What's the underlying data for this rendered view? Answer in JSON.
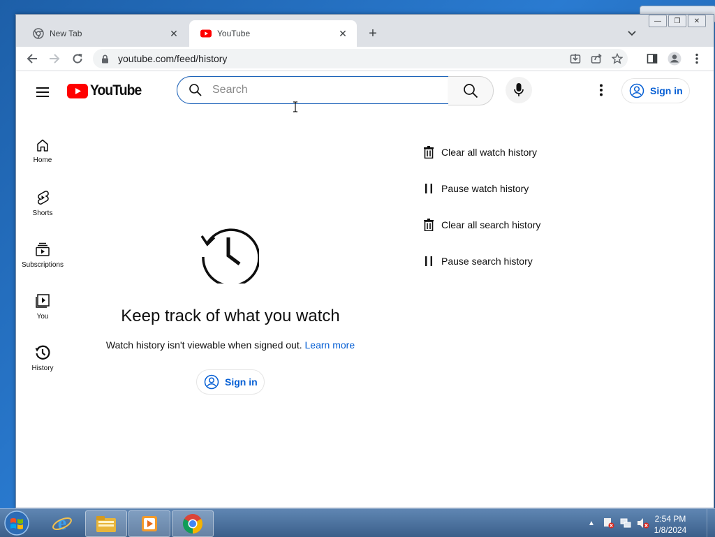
{
  "browser": {
    "tabs": [
      {
        "title": "New Tab",
        "active": false
      },
      {
        "title": "YouTube",
        "active": true
      }
    ],
    "url": "youtube.com/feed/history"
  },
  "youtube": {
    "logo_text": "YouTube",
    "search_placeholder": "Search",
    "signin_label": "Sign in",
    "nav": [
      {
        "label": "Home",
        "icon": "home-icon"
      },
      {
        "label": "Shorts",
        "icon": "shorts-icon"
      },
      {
        "label": "Subscriptions",
        "icon": "subscriptions-icon"
      },
      {
        "label": "You",
        "icon": "you-icon"
      },
      {
        "label": "History",
        "icon": "history-icon"
      }
    ],
    "empty_state": {
      "headline": "Keep track of what you watch",
      "message": "Watch history isn't viewable when signed out.",
      "link": "Learn more",
      "signin_label": "Sign in"
    },
    "actions": [
      {
        "label": "Clear all watch history",
        "icon": "trash-icon"
      },
      {
        "label": "Pause watch history",
        "icon": "pause-icon"
      },
      {
        "label": "Clear all search history",
        "icon": "trash-icon"
      },
      {
        "label": "Pause search history",
        "icon": "pause-icon"
      }
    ]
  },
  "taskbar": {
    "time": "2:54 PM",
    "date": "1/8/2024"
  },
  "colors": {
    "youtube_red": "#ff0000",
    "link_blue": "#065fd4"
  }
}
